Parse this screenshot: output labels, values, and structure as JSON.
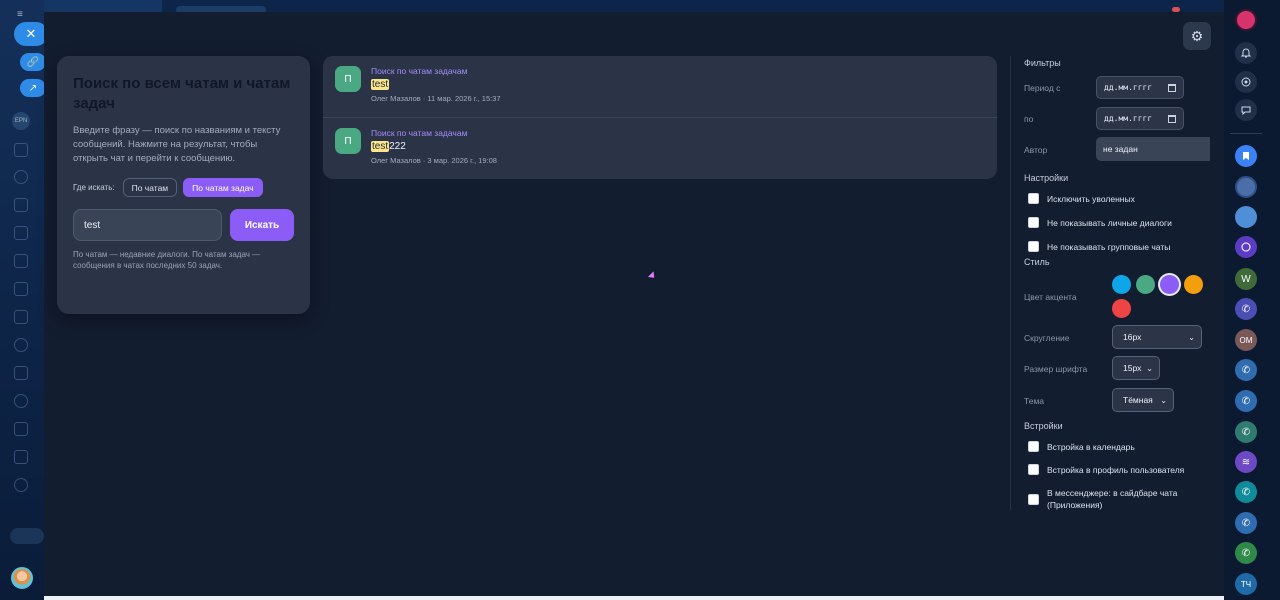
{
  "modal": {
    "settings_icon": "gear-icon"
  },
  "search": {
    "title": "Поиск по всем чатам и чатам задач",
    "description": "Введите фразу — поиск по названиям и тексту сообщений. Нажмите на результат, чтобы открыть чат и перейти к сообщению.",
    "where_label": "Где искать:",
    "scope_options": [
      "По чатам",
      "По чатам задач"
    ],
    "active_scope": "По чатам задач",
    "query": "test",
    "button_label": "Искать",
    "hint": "По чатам — недавние диалоги. По чатам задач — сообщения в чатах последних 50 задач."
  },
  "results": [
    {
      "avatar_letter": "П",
      "avatar_color": "#4aa883",
      "source": "Поиск по чатам задачам",
      "highlight": "test",
      "rest": "",
      "meta": "Олег Мазалов · 11 мар. 2026 г., 15:37"
    },
    {
      "avatar_letter": "П",
      "avatar_color": "#4aa883",
      "source": "Поиск по чатам задачам",
      "highlight": "test",
      "rest": "222",
      "meta": "Олег Мазалов · 3 мар. 2026 г., 19:08"
    }
  ],
  "filters": {
    "heading": "Фильтры",
    "period_from_label": "Период с",
    "period_to_label": "по",
    "date_placeholder": "дд.мм.гггг",
    "author_label": "Автор",
    "author_value": "не задан"
  },
  "settings": {
    "heading": "Настройки",
    "options": [
      {
        "label": "Исключить уволенных",
        "checked": false
      },
      {
        "label": "Не показывать личные диалоги",
        "checked": false
      },
      {
        "label": "Не показывать групповые чаты",
        "checked": false
      }
    ]
  },
  "style": {
    "heading": "Стиль",
    "accent_label": "Цвет акцента",
    "accent_colors": [
      "#0ea5e9",
      "#4aa883",
      "#8b5cf6",
      "#f59e0b",
      "#ef4444"
    ],
    "selected_accent": "#8b5cf6",
    "rounding_label": "Скругление",
    "rounding_value": "16px",
    "font_size_label": "Размер шрифта",
    "font_size_value": "15px",
    "theme_label": "Тема",
    "theme_value": "Тёмная"
  },
  "embeds": {
    "heading": "Встройки",
    "options": [
      {
        "label": "Встройка в календарь",
        "checked": false
      },
      {
        "label": "Встройка в профиль пользователя",
        "checked": false
      },
      {
        "label": "В мессенджере: в сайдбаре чата (Приложения)",
        "checked": false
      }
    ]
  },
  "background": {
    "close_icon": "close-icon",
    "user_chip": "EPN",
    "right_rail_badges": [
      "W",
      "ОМ",
      "ТЧ"
    ]
  }
}
